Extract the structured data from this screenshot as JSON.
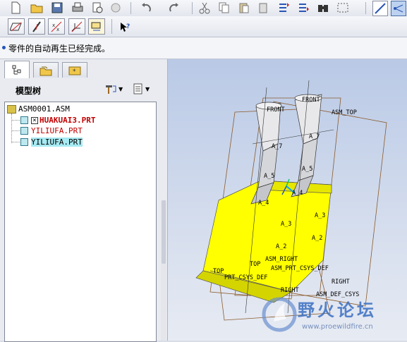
{
  "message_bar": {
    "text": "零件的自动再生已经完成。"
  },
  "model_tree": {
    "title": "模型树",
    "nodes": [
      {
        "label": "ASM0001.ASM",
        "color": "#000000",
        "bold": false,
        "highlight": false
      },
      {
        "label": "HUAKUAI3.PRT",
        "color": "#c00000",
        "bold": true,
        "highlight": false
      },
      {
        "label": "YILIUFA.PRT",
        "color": "#c00000",
        "bold": false,
        "highlight": false
      },
      {
        "label": "YILIUFA.PRT",
        "color": "#000000",
        "bold": false,
        "highlight": true
      }
    ]
  },
  "viewport": {
    "labels": [
      "FRONT",
      "FRONT",
      "ASM_TOP",
      "A_7",
      "A_7",
      "A_5",
      "A_5",
      "A_4",
      "A_4",
      "A_3",
      "A_3",
      "A_2",
      "A_2",
      "ASM_RIGHT",
      "TOP",
      "TOP",
      "ASM_PRT_CSYS_DEF",
      "PRT_CSYS_DEF",
      "RIGHT",
      "RIGHT",
      "ASM_DEF_CSYS"
    ],
    "body_color": "#ffff00"
  },
  "watermark": {
    "name": "野火论坛",
    "url": "www.proewildfire.cn"
  }
}
